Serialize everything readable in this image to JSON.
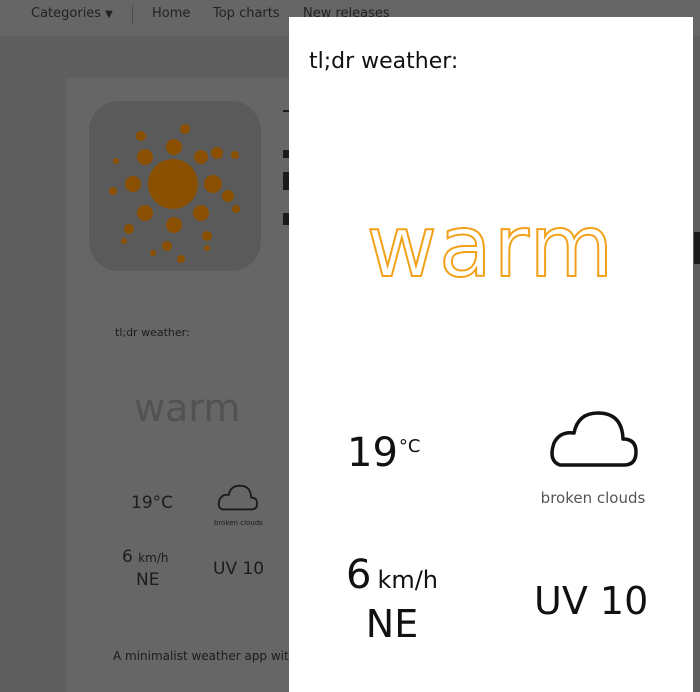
{
  "nav": {
    "categories": "Categories",
    "home": "Home",
    "top_charts": "Top charts",
    "new_releases": "New releases"
  },
  "background_app": {
    "widget_title": "tl;dr weather:",
    "condition": "warm",
    "temperature": "19°C",
    "cloud_desc": "broken clouds",
    "wind_value": "6",
    "wind_unit": "km/h",
    "wind_dir": "NE",
    "uv": "UV 10",
    "description": "A minimalist weather app with"
  },
  "modal": {
    "title": "tl;dr weather:",
    "condition": "warm",
    "temperature_value": "19",
    "temperature_unit": "°C",
    "cloud_desc": "broken clouds",
    "wind_value": "6",
    "wind_unit": "km/h",
    "wind_dir": "NE",
    "uv": "UV 10"
  },
  "colors": {
    "accent": "#f2a21a",
    "overlay": "#5f5f5f",
    "modal_bg": "#ffffff"
  },
  "icons": {
    "app_icon": "sun-logo-icon",
    "cloud": "cloud-icon",
    "categories_chevron": "chevron-down-icon"
  }
}
